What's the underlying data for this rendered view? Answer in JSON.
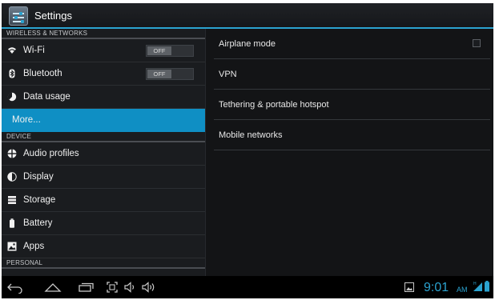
{
  "app": {
    "title": "Settings",
    "icon": "settings-app-icon",
    "accent_color": "#2ba3d0",
    "selected_color": "#0f8fc4"
  },
  "sidebar": {
    "sections": [
      {
        "header": "WIRELESS & NETWORKS",
        "items": [
          {
            "label": "Wi-Fi",
            "icon": "wifi-icon",
            "toggle": "OFF"
          },
          {
            "label": "Bluetooth",
            "icon": "bluetooth-icon",
            "toggle": "OFF"
          },
          {
            "label": "Data usage",
            "icon": "data-usage-icon"
          },
          {
            "label": "More...",
            "selected": true
          }
        ]
      },
      {
        "header": "DEVICE",
        "items": [
          {
            "label": "Audio profiles",
            "icon": "audio-profiles-icon"
          },
          {
            "label": "Display",
            "icon": "display-icon"
          },
          {
            "label": "Storage",
            "icon": "storage-icon"
          },
          {
            "label": "Battery",
            "icon": "battery-icon"
          },
          {
            "label": "Apps",
            "icon": "apps-icon"
          }
        ]
      },
      {
        "header": "PERSONAL",
        "items": []
      }
    ]
  },
  "main": {
    "items": [
      {
        "label": "Airplane mode",
        "checkbox": false
      },
      {
        "label": "VPN"
      },
      {
        "label": "Tethering & portable hotspot"
      },
      {
        "label": "Mobile networks"
      }
    ]
  },
  "navbar": {
    "buttons": [
      "back-icon",
      "home-icon",
      "recent-apps-icon",
      "screenshot-icon",
      "volume-down-icon",
      "volume-up-icon"
    ],
    "time": "9:01",
    "ampm": "AM",
    "status_icons": [
      "gallery-notification-icon",
      "signal-icon",
      "battery-status-icon"
    ]
  }
}
